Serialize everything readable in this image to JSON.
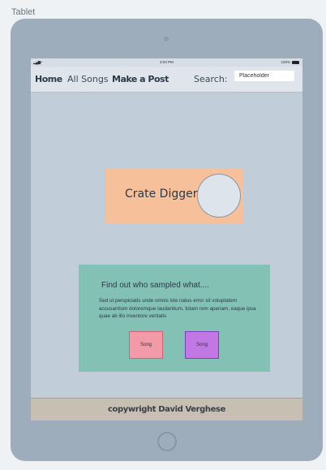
{
  "frame": {
    "label": "Tablet"
  },
  "status_bar": {
    "signal": "▂▄▆ •",
    "time": "3:03 PM",
    "battery": "100%"
  },
  "nav": {
    "home": "Home",
    "all_songs": "All Songs",
    "make_post": "Make a Post",
    "search_label": "Search:",
    "search_placeholder": "Placeholder"
  },
  "hero": {
    "title": "Crate Digger"
  },
  "info": {
    "heading": "Find out who sampled what....",
    "body": "Sed ut perspiciatis unde omnis iste natus error sit voluptatem accusantium doloremque laudantium, totam rem aperiam, eaque ipsa quae ab illo inventore veritatis",
    "song_buttons": [
      "Song",
      "Song"
    ]
  },
  "footer": {
    "text": "copywright David Verghese"
  },
  "colors": {
    "screen_bg": "#c1cdd8",
    "hero_bg": "#f6c09a",
    "card_bg": "#82c1b3",
    "song1_bg": "#f29aa8",
    "song2_bg": "#c278e2",
    "footer_bg": "#c7bfb2"
  },
  "icons": [
    "signal-icon",
    "wifi-icon",
    "battery-icon",
    "camera-icon",
    "home-button-icon"
  ]
}
